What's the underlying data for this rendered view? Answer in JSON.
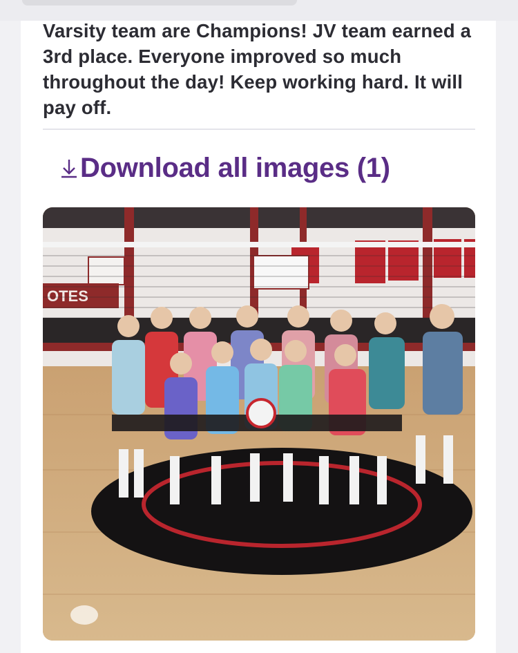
{
  "post": {
    "body_text": "Varsity team are Champions! JV team earned a 3rd place. Everyone improved so much throughout the day! Keep working hard. It will pay off."
  },
  "download": {
    "label": "Download all images (1)",
    "icon": "download-icon"
  },
  "photo": {
    "wall_banner_text": "OTES"
  },
  "colors": {
    "link": "#5a2d86",
    "text": "#2c2c33",
    "divider": "#e4e4ea"
  }
}
